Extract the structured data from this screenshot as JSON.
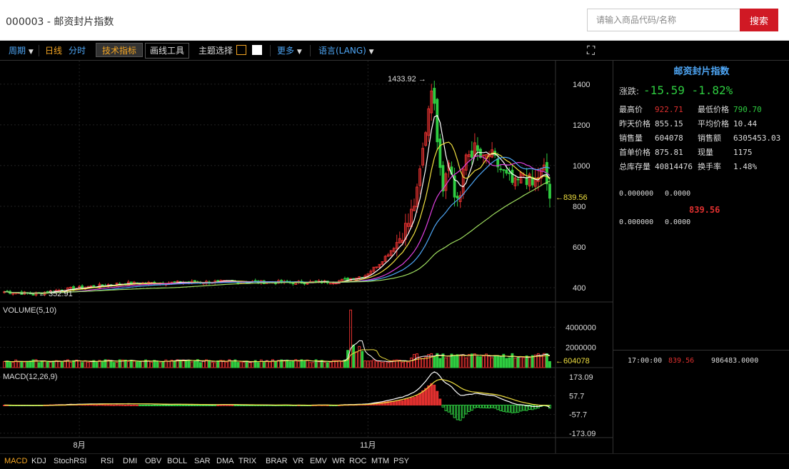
{
  "header": {
    "title": "000003 - 邮资封片指数",
    "search_placeholder": "请输入商品代码/名称",
    "search_button": "搜索"
  },
  "toolbar": {
    "period": "周期",
    "period_arrow": "▼",
    "daily": "日线",
    "intraday": "分时",
    "tech": "技术指标",
    "draw": "画线工具",
    "theme": "主题选择",
    "more": "更多",
    "more_arrow": "▼",
    "lang": "语言(LANG)",
    "lang_arrow": "▼",
    "fullscreen_icon": "⛶"
  },
  "colors": {
    "up": "#e0302f",
    "down": "#2ecc40",
    "ma5": "#ffffff",
    "ma10": "#f0e040",
    "ma20": "#e040e0",
    "ma30": "#4ea6f5",
    "ma60": "#a0e060",
    "theme_swatch_1": "#f5a623",
    "theme_swatch_2": "#ffffff"
  },
  "right_panel": {
    "name": "邮资封片指数",
    "change_label": "涨跌:",
    "change_value": "-15.59 -1.82%",
    "rows": [
      {
        "k1": "最高价",
        "v1": "922.71",
        "k2": "最低价格",
        "v2": "790.70",
        "c1": "red",
        "c2": "green"
      },
      {
        "k1": "昨天价格",
        "v1": "855.15",
        "k2": "平均价格",
        "v2": "10.44",
        "c1": "",
        "c2": ""
      },
      {
        "k1": "销售量",
        "v1": "604078",
        "k2": "销售额",
        "v2": "6305453.03",
        "c1": "",
        "c2": ""
      },
      {
        "k1": "首单价格",
        "v1": "875.81",
        "k2": "现量",
        "v2": "1175",
        "c1": "",
        "c2": ""
      },
      {
        "k1": "总库存量",
        "v1": "40814476",
        "k2": "换手率",
        "v2": "1.48%",
        "c1": "",
        "c2": ""
      }
    ],
    "book_top_left": "0.000000",
    "book_top_right": "0.0000",
    "book_mid_price": "839.56",
    "book_bot_left": "0.000000",
    "book_bot_right": "0.0000",
    "tick_time": "17:00:00",
    "tick_price": "839.56",
    "tick_volume": "986483.0000"
  },
  "chart_data": {
    "type": "candlestick",
    "price_axis": {
      "ticks": [
        "1400",
        "1200",
        "1000",
        "800",
        "600",
        "400"
      ],
      "min": 330,
      "max": 1480
    },
    "max_label": "1433.92 →",
    "min_label": "← 352.91",
    "last_label": "←839.56",
    "volume_title": "VOLUME(5,10)",
    "volume_axis": {
      "ticks": [
        "4000000",
        "2000000"
      ],
      "max": 6000000
    },
    "volume_last_label": "←604078",
    "macd_title": "MACD(12,26,9)",
    "macd_axis": {
      "ticks": [
        "173.09",
        "57.7",
        "-57.7",
        "-173.09"
      ],
      "min": -200,
      "max": 200
    },
    "x_labels": [
      {
        "label": "8月",
        "index": 26
      },
      {
        "label": "11月",
        "index": 126
      }
    ],
    "anchors": [
      [
        0,
        380
      ],
      [
        10,
        370
      ],
      [
        20,
        390
      ],
      [
        40,
        420
      ],
      [
        60,
        425
      ],
      [
        80,
        430
      ],
      [
        100,
        425
      ],
      [
        115,
        430
      ],
      [
        120,
        445
      ],
      [
        125,
        460
      ],
      [
        130,
        520
      ],
      [
        135,
        600
      ],
      [
        140,
        720
      ],
      [
        143,
        860
      ],
      [
        146,
        1180
      ],
      [
        148,
        1400
      ],
      [
        150,
        1150
      ],
      [
        152,
        900
      ],
      [
        154,
        1050
      ],
      [
        156,
        850
      ],
      [
        158,
        850
      ],
      [
        160,
        1050
      ],
      [
        163,
        1080
      ],
      [
        166,
        1020
      ],
      [
        168,
        1060
      ],
      [
        171,
        1000
      ],
      [
        174,
        940
      ],
      [
        177,
        900
      ],
      [
        180,
        960
      ],
      [
        183,
        900
      ],
      [
        185,
        950
      ],
      [
        187,
        980
      ],
      [
        189,
        840
      ]
    ],
    "indicators": [
      "MACD",
      "KDJ",
      "StochRSI",
      "RSI",
      "DMI",
      "OBV",
      "BOLL",
      "SAR",
      "DMA",
      "TRIX",
      "BRAR",
      "VR",
      "EMV",
      "WR",
      "ROC",
      "MTM",
      "PSY"
    ]
  }
}
